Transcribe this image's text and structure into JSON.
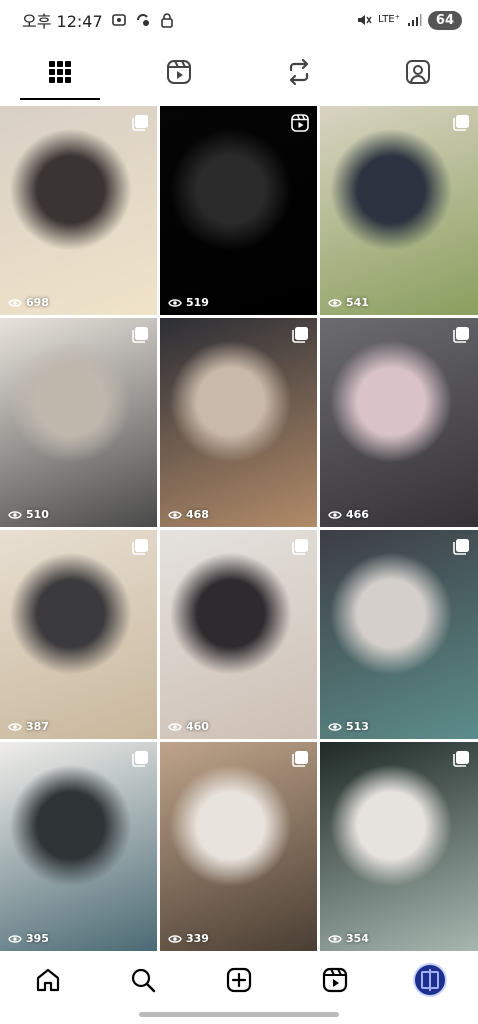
{
  "status_bar": {
    "time": "오후 12:47",
    "network": "LTE⁺",
    "battery": "64"
  },
  "tabs": [
    {
      "name": "posts-grid",
      "icon": "grid-icon",
      "active": true
    },
    {
      "name": "reels",
      "icon": "reels-icon",
      "active": false
    },
    {
      "name": "reposts",
      "icon": "repost-icon",
      "active": false
    },
    {
      "name": "tagged",
      "icon": "tagged-person-icon",
      "active": false
    }
  ],
  "grid": {
    "tiles": [
      {
        "views": "698",
        "type": "carousel",
        "colors": [
          "#d9d0c5",
          "#3a3433",
          "#f0e3c9"
        ]
      },
      {
        "views": "519",
        "type": "reel",
        "colors": [
          "#050505",
          "#2a2a2a",
          "#000000"
        ]
      },
      {
        "views": "541",
        "type": "carousel",
        "colors": [
          "#d9d4c2",
          "#2b3440",
          "#8a9f5e"
        ]
      },
      {
        "views": "510",
        "type": "carousel",
        "colors": [
          "#e8e3dc",
          "#bfb8ad",
          "#4a4a4a"
        ]
      },
      {
        "views": "468",
        "type": "carousel",
        "colors": [
          "#2c2e35",
          "#c9b9a9",
          "#b28b68"
        ]
      },
      {
        "views": "466",
        "type": "carousel",
        "colors": [
          "#6c6b70",
          "#d9c3c8",
          "#343235"
        ]
      },
      {
        "views": "387",
        "type": "carousel",
        "colors": [
          "#e8dfd2",
          "#3b3a3c",
          "#c8b79c"
        ]
      },
      {
        "views": "460",
        "type": "carousel",
        "colors": [
          "#e5e2de",
          "#2e2b2e",
          "#cdbfb4"
        ]
      },
      {
        "views": "513",
        "type": "carousel",
        "colors": [
          "#3c3d44",
          "#d4cfcb",
          "#5c8d8a"
        ]
      },
      {
        "views": "395",
        "type": "carousel",
        "colors": [
          "#f0eeea",
          "#2f3437",
          "#4b6a74"
        ]
      },
      {
        "views": "339",
        "type": "carousel",
        "colors": [
          "#bfa48a",
          "#e9e3dd",
          "#4a3e33"
        ]
      },
      {
        "views": "354",
        "type": "carousel",
        "colors": [
          "#1f2a27",
          "#e6e2de",
          "#a7b7b0"
        ]
      }
    ]
  },
  "bottom_nav": [
    {
      "name": "home",
      "icon": "home-icon"
    },
    {
      "name": "search",
      "icon": "search-icon"
    },
    {
      "name": "create",
      "icon": "plus-square-icon"
    },
    {
      "name": "reels",
      "icon": "reels-icon"
    },
    {
      "name": "profile",
      "icon": "profile-avatar"
    }
  ]
}
